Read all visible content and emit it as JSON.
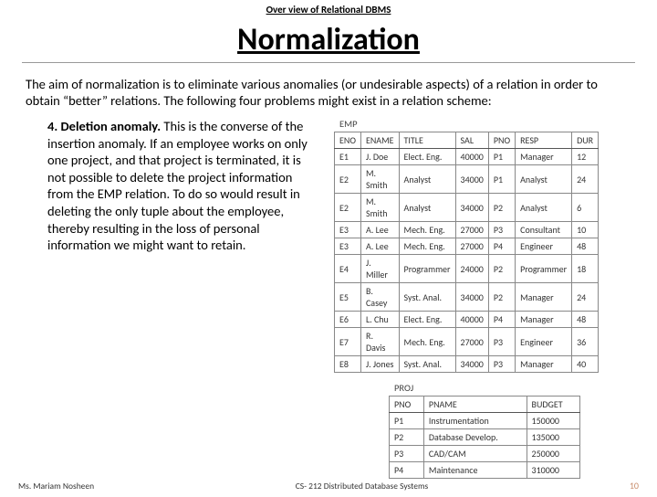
{
  "header": {
    "overline": "Over view of Relational DBMS",
    "title": "Normalization"
  },
  "intro": "The aim of normalization is to eliminate various anomalies (or undesirable aspects) of a relation in order to obtain “better” relations. The following four problems might exist in a relation scheme:",
  "paragraph": {
    "lead": "4. Deletion anomaly.",
    "text": " This is the converse of the insertion anomaly. If an employee works on only one project, and that project is terminated, it is not possible to delete the project information from the EMP relation. To do so would result in deleting the only tuple about the employee, thereby resulting in the loss of personal information we might want to retain."
  },
  "emp": {
    "label": "EMP",
    "headers": [
      "ENO",
      "ENAME",
      "TITLE",
      "SAL",
      "PNO",
      "RESP",
      "DUR"
    ],
    "rows": [
      [
        "E1",
        "J. Doe",
        "Elect. Eng.",
        "40000",
        "P1",
        "Manager",
        "12"
      ],
      [
        "E2",
        "M. Smith",
        "Analyst",
        "34000",
        "P1",
        "Analyst",
        "24"
      ],
      [
        "E2",
        "M. Smith",
        "Analyst",
        "34000",
        "P2",
        "Analyst",
        "6"
      ],
      [
        "E3",
        "A. Lee",
        "Mech. Eng.",
        "27000",
        "P3",
        "Consultant",
        "10"
      ],
      [
        "E3",
        "A. Lee",
        "Mech. Eng.",
        "27000",
        "P4",
        "Engineer",
        "48"
      ],
      [
        "E4",
        "J. Miller",
        "Programmer",
        "24000",
        "P2",
        "Programmer",
        "18"
      ],
      [
        "E5",
        "B. Casey",
        "Syst. Anal.",
        "34000",
        "P2",
        "Manager",
        "24"
      ],
      [
        "E6",
        "L. Chu",
        "Elect. Eng.",
        "40000",
        "P4",
        "Manager",
        "48"
      ],
      [
        "E7",
        "R. Davis",
        "Mech. Eng.",
        "27000",
        "P3",
        "Engineer",
        "36"
      ],
      [
        "E8",
        "J. Jones",
        "Syst. Anal.",
        "34000",
        "P3",
        "Manager",
        "40"
      ]
    ]
  },
  "proj": {
    "label": "PROJ",
    "headers": [
      "PNO",
      "PNAME",
      "BUDGET"
    ],
    "rows": [
      [
        "P1",
        "Instrumentation",
        "150000"
      ],
      [
        "P2",
        "Database Develop.",
        "135000"
      ],
      [
        "P3",
        "CAD/CAM",
        "250000"
      ],
      [
        "P4",
        "Maintenance",
        "310000"
      ]
    ]
  },
  "footer": {
    "author": "Ms. Mariam Nosheen",
    "course": "CS- 212 Distributed Database Systems",
    "page": "10"
  }
}
